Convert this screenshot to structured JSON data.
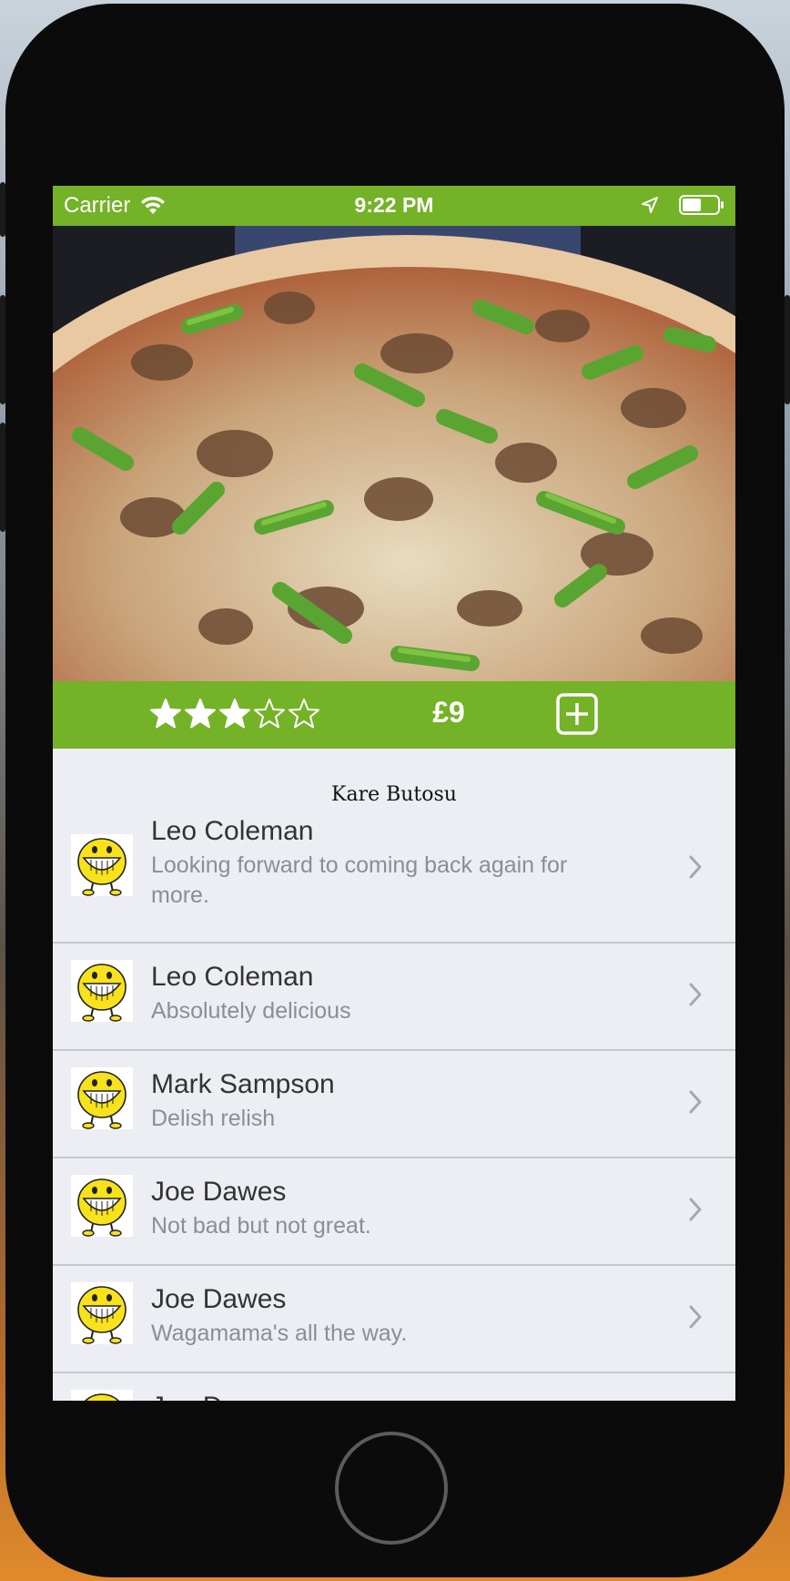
{
  "status_bar": {
    "carrier": "Carrier",
    "time": "9:22 PM"
  },
  "dish": {
    "rating": 3,
    "rating_max": 5,
    "price": "£9",
    "image_description_icon": "pizza-photo"
  },
  "section": {
    "title": "Kare Butosu"
  },
  "reviews": [
    {
      "name": "Leo Coleman",
      "comment": "Looking forward to coming back again for more."
    },
    {
      "name": "Leo Coleman",
      "comment": "Absolutely delicious"
    },
    {
      "name": "Mark Sampson",
      "comment": "Delish relish"
    },
    {
      "name": "Joe Dawes",
      "comment": "Not bad but not great."
    },
    {
      "name": "Joe Dawes",
      "comment": "Wagamama's all the way."
    },
    {
      "name": "Joe Dawes",
      "comment": ""
    }
  ],
  "colors": {
    "accent": "#74b227",
    "background": "#eceef3",
    "comment_text": "#8a8e98"
  }
}
